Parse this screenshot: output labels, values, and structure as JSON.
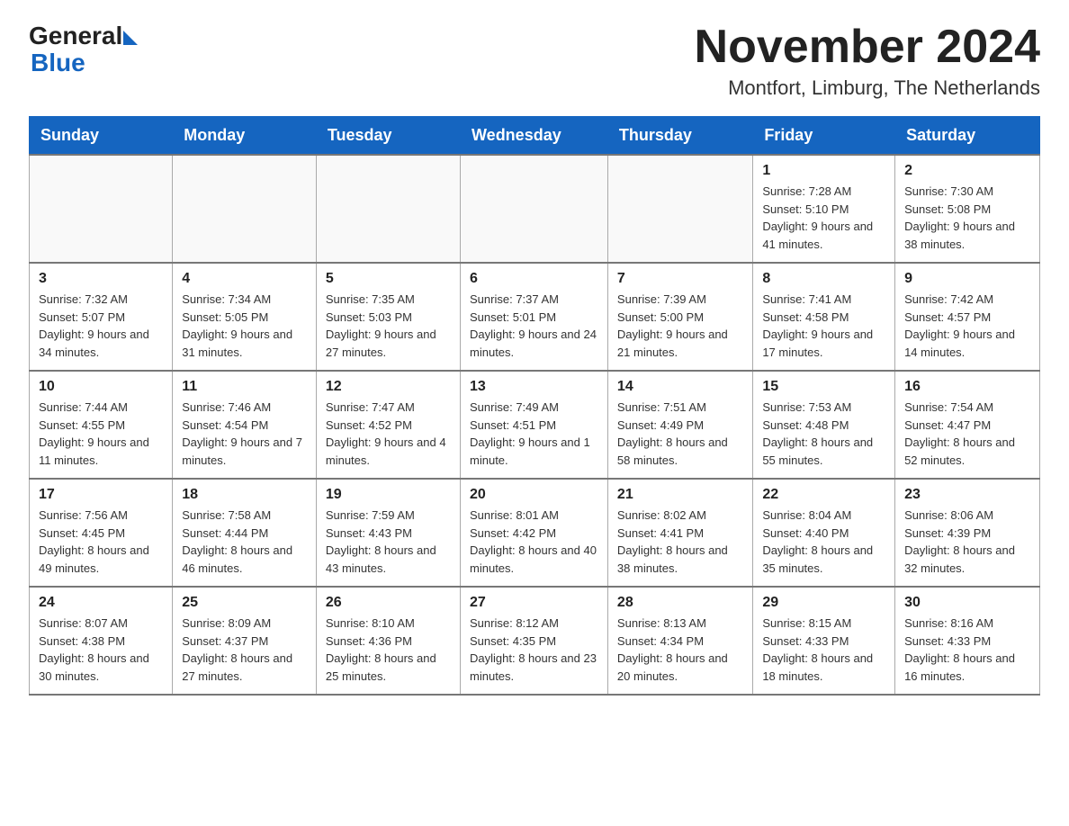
{
  "header": {
    "logo_general": "General",
    "logo_blue": "Blue",
    "title": "November 2024",
    "subtitle": "Montfort, Limburg, The Netherlands"
  },
  "calendar": {
    "days_of_week": [
      "Sunday",
      "Monday",
      "Tuesday",
      "Wednesday",
      "Thursday",
      "Friday",
      "Saturday"
    ],
    "weeks": [
      [
        {
          "day": "",
          "info": ""
        },
        {
          "day": "",
          "info": ""
        },
        {
          "day": "",
          "info": ""
        },
        {
          "day": "",
          "info": ""
        },
        {
          "day": "",
          "info": ""
        },
        {
          "day": "1",
          "info": "Sunrise: 7:28 AM\nSunset: 5:10 PM\nDaylight: 9 hours and 41 minutes."
        },
        {
          "day": "2",
          "info": "Sunrise: 7:30 AM\nSunset: 5:08 PM\nDaylight: 9 hours and 38 minutes."
        }
      ],
      [
        {
          "day": "3",
          "info": "Sunrise: 7:32 AM\nSunset: 5:07 PM\nDaylight: 9 hours and 34 minutes."
        },
        {
          "day": "4",
          "info": "Sunrise: 7:34 AM\nSunset: 5:05 PM\nDaylight: 9 hours and 31 minutes."
        },
        {
          "day": "5",
          "info": "Sunrise: 7:35 AM\nSunset: 5:03 PM\nDaylight: 9 hours and 27 minutes."
        },
        {
          "day": "6",
          "info": "Sunrise: 7:37 AM\nSunset: 5:01 PM\nDaylight: 9 hours and 24 minutes."
        },
        {
          "day": "7",
          "info": "Sunrise: 7:39 AM\nSunset: 5:00 PM\nDaylight: 9 hours and 21 minutes."
        },
        {
          "day": "8",
          "info": "Sunrise: 7:41 AM\nSunset: 4:58 PM\nDaylight: 9 hours and 17 minutes."
        },
        {
          "day": "9",
          "info": "Sunrise: 7:42 AM\nSunset: 4:57 PM\nDaylight: 9 hours and 14 minutes."
        }
      ],
      [
        {
          "day": "10",
          "info": "Sunrise: 7:44 AM\nSunset: 4:55 PM\nDaylight: 9 hours and 11 minutes."
        },
        {
          "day": "11",
          "info": "Sunrise: 7:46 AM\nSunset: 4:54 PM\nDaylight: 9 hours and 7 minutes."
        },
        {
          "day": "12",
          "info": "Sunrise: 7:47 AM\nSunset: 4:52 PM\nDaylight: 9 hours and 4 minutes."
        },
        {
          "day": "13",
          "info": "Sunrise: 7:49 AM\nSunset: 4:51 PM\nDaylight: 9 hours and 1 minute."
        },
        {
          "day": "14",
          "info": "Sunrise: 7:51 AM\nSunset: 4:49 PM\nDaylight: 8 hours and 58 minutes."
        },
        {
          "day": "15",
          "info": "Sunrise: 7:53 AM\nSunset: 4:48 PM\nDaylight: 8 hours and 55 minutes."
        },
        {
          "day": "16",
          "info": "Sunrise: 7:54 AM\nSunset: 4:47 PM\nDaylight: 8 hours and 52 minutes."
        }
      ],
      [
        {
          "day": "17",
          "info": "Sunrise: 7:56 AM\nSunset: 4:45 PM\nDaylight: 8 hours and 49 minutes."
        },
        {
          "day": "18",
          "info": "Sunrise: 7:58 AM\nSunset: 4:44 PM\nDaylight: 8 hours and 46 minutes."
        },
        {
          "day": "19",
          "info": "Sunrise: 7:59 AM\nSunset: 4:43 PM\nDaylight: 8 hours and 43 minutes."
        },
        {
          "day": "20",
          "info": "Sunrise: 8:01 AM\nSunset: 4:42 PM\nDaylight: 8 hours and 40 minutes."
        },
        {
          "day": "21",
          "info": "Sunrise: 8:02 AM\nSunset: 4:41 PM\nDaylight: 8 hours and 38 minutes."
        },
        {
          "day": "22",
          "info": "Sunrise: 8:04 AM\nSunset: 4:40 PM\nDaylight: 8 hours and 35 minutes."
        },
        {
          "day": "23",
          "info": "Sunrise: 8:06 AM\nSunset: 4:39 PM\nDaylight: 8 hours and 32 minutes."
        }
      ],
      [
        {
          "day": "24",
          "info": "Sunrise: 8:07 AM\nSunset: 4:38 PM\nDaylight: 8 hours and 30 minutes."
        },
        {
          "day": "25",
          "info": "Sunrise: 8:09 AM\nSunset: 4:37 PM\nDaylight: 8 hours and 27 minutes."
        },
        {
          "day": "26",
          "info": "Sunrise: 8:10 AM\nSunset: 4:36 PM\nDaylight: 8 hours and 25 minutes."
        },
        {
          "day": "27",
          "info": "Sunrise: 8:12 AM\nSunset: 4:35 PM\nDaylight: 8 hours and 23 minutes."
        },
        {
          "day": "28",
          "info": "Sunrise: 8:13 AM\nSunset: 4:34 PM\nDaylight: 8 hours and 20 minutes."
        },
        {
          "day": "29",
          "info": "Sunrise: 8:15 AM\nSunset: 4:33 PM\nDaylight: 8 hours and 18 minutes."
        },
        {
          "day": "30",
          "info": "Sunrise: 8:16 AM\nSunset: 4:33 PM\nDaylight: 8 hours and 16 minutes."
        }
      ]
    ]
  }
}
